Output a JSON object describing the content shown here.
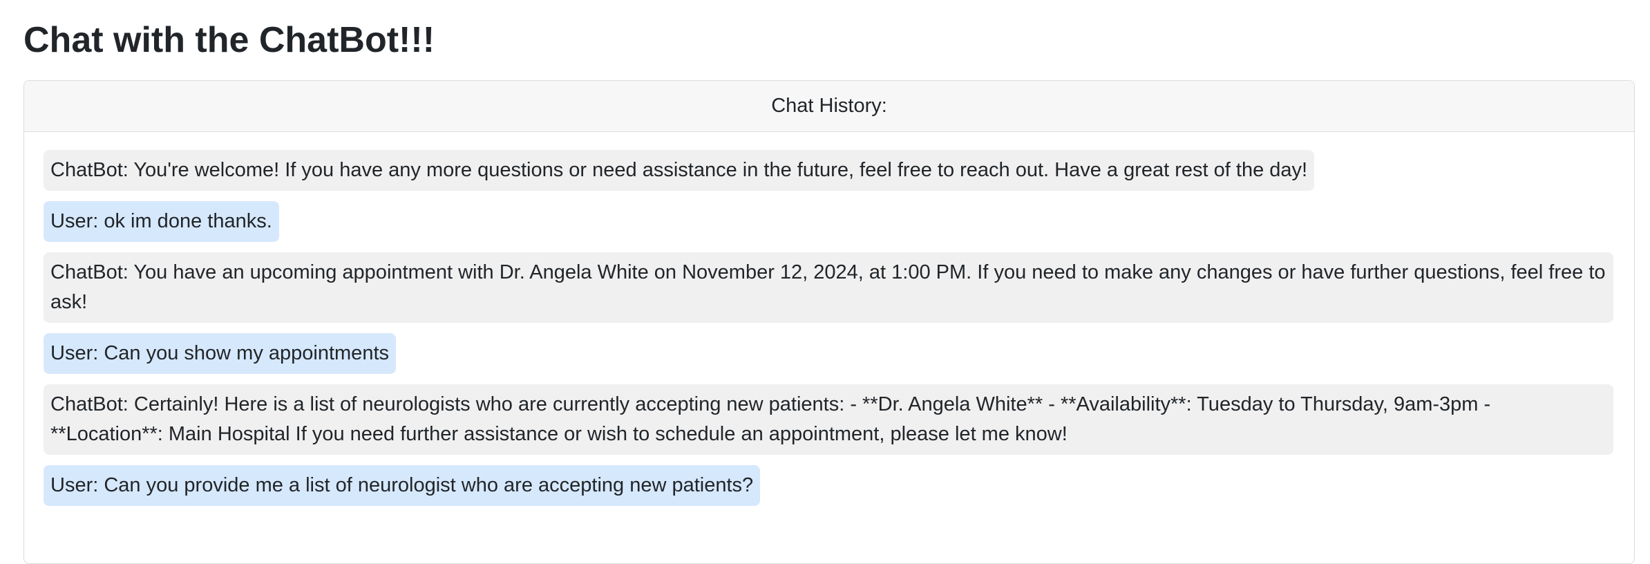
{
  "page": {
    "title": "Chat with the ChatBot!!!"
  },
  "chat_card": {
    "header": "Chat History:"
  },
  "messages": [
    {
      "sender": "bot",
      "text": "ChatBot: You're welcome! If you have any more questions or need assistance in the future, feel free to reach out. Have a great rest of the day!"
    },
    {
      "sender": "user",
      "text": "User: ok im done thanks."
    },
    {
      "sender": "bot",
      "text": "ChatBot: You have an upcoming appointment with Dr. Angela White on November 12, 2024, at 1:00 PM. If you need to make any changes or have further questions, feel free to ask!"
    },
    {
      "sender": "user",
      "text": "User: Can you show my appointments"
    },
    {
      "sender": "bot",
      "text": "ChatBot: Certainly! Here is a list of neurologists who are currently accepting new patients: - **Dr. Angela White** - **Availability**: Tuesday to Thursday, 9am-3pm - **Location**: Main Hospital If you need further assistance or wish to schedule an appointment, please let me know!"
    },
    {
      "sender": "user",
      "text": "User: Can you provide me a list of neurologist who are accepting new patients?"
    }
  ],
  "colors": {
    "bot_bubble": "#f0f0f0",
    "user_bubble": "#d6e8fc",
    "card_header_bg": "#f7f7f7",
    "border": "#dcdcdc",
    "text": "#212529"
  }
}
